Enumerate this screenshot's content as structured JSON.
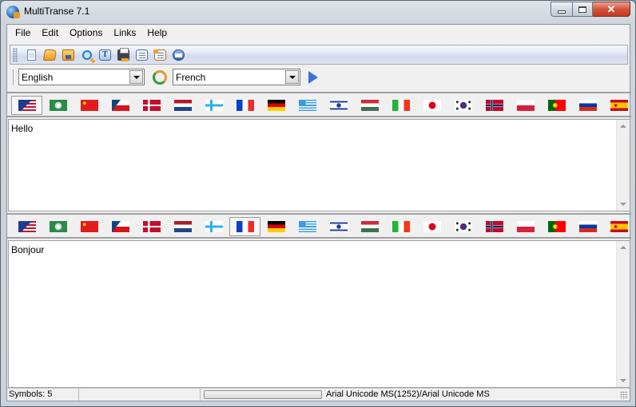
{
  "window": {
    "title": "MultiTranse 7.1",
    "controls": {
      "minimize": "minimize",
      "maximize": "maximize",
      "close": "✕"
    }
  },
  "menu": [
    "File",
    "Edit",
    "Options",
    "Links",
    "Help"
  ],
  "toolbar": {
    "icons": [
      "new-document",
      "open-folder",
      "save",
      "find",
      "text-font",
      "print",
      "document-list",
      "dictionary",
      "send-mail"
    ]
  },
  "language": {
    "source": "English",
    "target": "French",
    "swap_icon": "swap-languages",
    "translate_icon": "play-translate"
  },
  "flags": [
    "English (US/UK)",
    "Arabic",
    "Chinese",
    "Czech",
    "Danish",
    "Dutch",
    "Finnish",
    "French",
    "German",
    "Greek",
    "Hebrew",
    "Hungarian",
    "Italian",
    "Japanese",
    "Korean",
    "Norwegian",
    "Polish",
    "Portuguese",
    "Russian",
    "Spanish"
  ],
  "source_flag_selected": "English (US/UK)",
  "target_flag_selected": "French",
  "source_text": "Hello",
  "target_text": "Bonjour",
  "status": {
    "symbols": "Symbols: 5",
    "empty": "",
    "font": "Arial Unicode MS(1252)/Arial Unicode MS"
  }
}
